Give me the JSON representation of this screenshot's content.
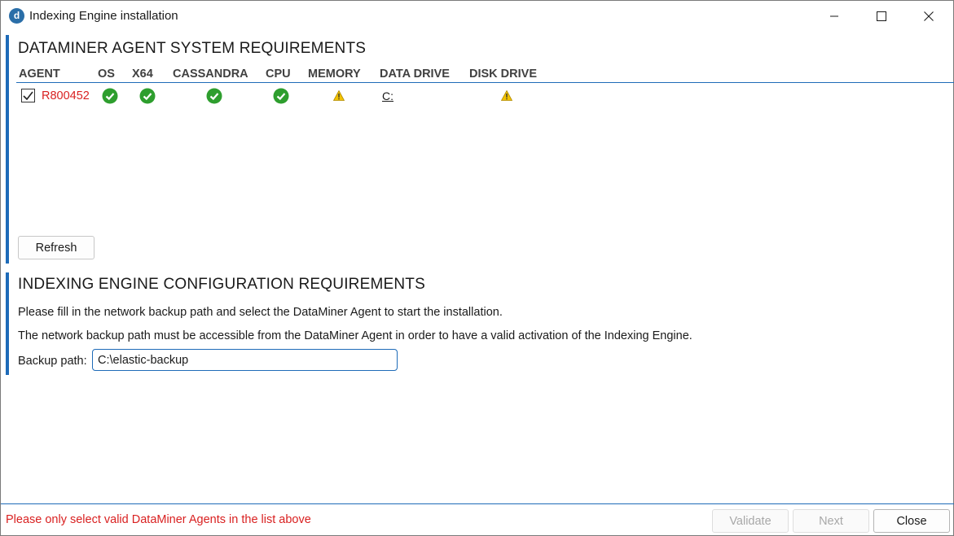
{
  "window": {
    "title": "Indexing Engine installation",
    "icon_letter": "d"
  },
  "system_requirements": {
    "title": "DATAMINER AGENT SYSTEM REQUIREMENTS",
    "columns": [
      "AGENT",
      "OS",
      "X64",
      "CASSANDRA",
      "CPU",
      "MEMORY",
      "DATA DRIVE",
      "DISK DRIVE"
    ],
    "rows": [
      {
        "selected": true,
        "agent": "R800452",
        "os": "ok",
        "x64": "ok",
        "cassandra": "ok",
        "cpu": "ok",
        "memory": "warning",
        "data_drive": "C:",
        "disk_drive": "warning"
      }
    ],
    "refresh_label": "Refresh"
  },
  "configuration": {
    "title": "INDEXING ENGINE CONFIGURATION REQUIREMENTS",
    "instruction_1": "Please fill in the network backup path and select the DataMiner Agent to start the installation.",
    "instruction_2": "The network backup path must be accessible from the DataMiner Agent in order to have a valid activation of the Indexing Engine.",
    "backup_path_label": "Backup path:",
    "backup_path_value": "C:\\elastic-backup"
  },
  "footer": {
    "message": "Please only select valid DataMiner Agents in the list above",
    "validate_label": "Validate",
    "next_label": "Next",
    "close_label": "Close"
  },
  "colors": {
    "accent": "#1e6bb8",
    "error": "#d92121",
    "ok": "#2e9e2e",
    "warning": "#f2c200"
  },
  "icons": {
    "ok": "check-circle-icon",
    "warning": "warning-triangle-icon",
    "checkbox": "checkbox-checked-icon"
  }
}
